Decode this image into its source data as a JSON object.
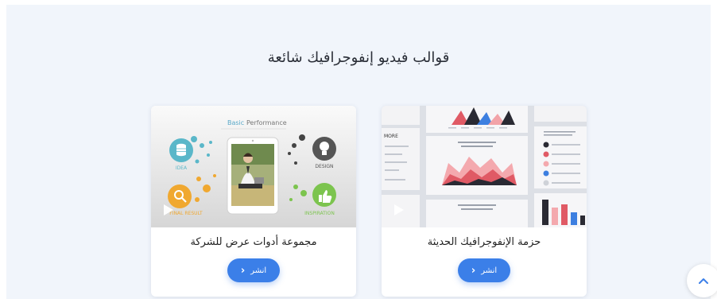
{
  "section": {
    "title": "قوالب فيديو إنفوجرافيك شائعة"
  },
  "cards": [
    {
      "title": "مجموعة أدوات عرض للشركة",
      "button_label": "انشر",
      "thumb_text": {
        "header_basic": "Basic",
        "header_rest": "Performance",
        "idea": "IDEA",
        "design": "DESIGN",
        "final_result": "FINAL RESULT",
        "inspiration": "INSPIRATION"
      }
    },
    {
      "title": "حزمة الإنفوجرافيك الحديثة",
      "button_label": "انشر",
      "thumb_text": {
        "more": "MORE"
      }
    }
  ],
  "icons": {
    "play": "play-icon",
    "chevron_button": "chevron-left-icon",
    "scroll_top": "chevron-up-icon"
  },
  "colors": {
    "accent": "#3b7fe8",
    "section_bg": "#f1f5fb"
  }
}
